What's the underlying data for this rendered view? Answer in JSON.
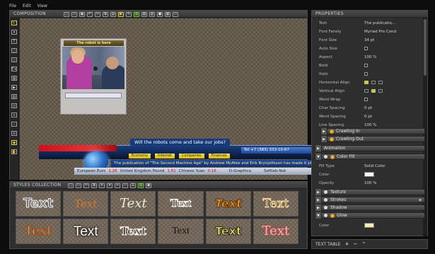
{
  "menu": [
    "File",
    "Edit",
    "View"
  ],
  "composition": {
    "title": "COMPOSITION",
    "photo_title": "The robot is here",
    "lower_third": {
      "question": "Will the robots come and take our jobs?",
      "tel": "Tel  +7 (383) 333-10-67",
      "tabs": [
        "Economy",
        "Internet",
        "Companies",
        "Finances"
      ],
      "ticker": "The publication of \"The Second Machine Age\" by Andrew McAfee and Erik Brynjolfsson has made it plain",
      "rates": [
        {
          "label": "European Euro",
          "value": "1.26"
        },
        {
          "label": "United Kingdom Pound",
          "value": "1.61"
        },
        {
          "label": "Chinese Yuan",
          "value": "0.16"
        }
      ],
      "brand1": "D-Graphica",
      "brand2": "Softlab-Nsk"
    }
  },
  "styles": {
    "title": "STYLES COLLECTION",
    "tiles": [
      "Text",
      "Text",
      "Text",
      "Text",
      "Text",
      "Text",
      "Text",
      "Text",
      "Text",
      "Text",
      "Text",
      "Text"
    ]
  },
  "properties": {
    "title": "PROPERTIES",
    "rows": [
      {
        "k": "Text",
        "v": "The publicatio..."
      },
      {
        "k": "Font Family",
        "v": "Myriad Pro Cond"
      },
      {
        "k": "Font Size",
        "v": "34 pt"
      },
      {
        "k": "Auto Size",
        "v": ""
      },
      {
        "k": "Aspect",
        "v": "100 %"
      },
      {
        "k": "Bold",
        "v": ""
      },
      {
        "k": "Italic",
        "v": ""
      },
      {
        "k": "Horizontal Align",
        "v": ""
      },
      {
        "k": "Vertical Align",
        "v": ""
      },
      {
        "k": "Word Wrap",
        "v": ""
      },
      {
        "k": "Char Spacing",
        "v": "0 pt"
      },
      {
        "k": "Word Spacing",
        "v": "0 pt"
      },
      {
        "k": "Line Spacing",
        "v": "100 %"
      }
    ],
    "sections": {
      "crawling_in": "Crawling In",
      "crawling_out": "Crawling Out",
      "animation": "Animation",
      "color_fill": "Color Fill",
      "texture": "Texture",
      "strokes": "Strokes",
      "shadow": "Shadow",
      "glow": "Glow"
    },
    "fill": [
      {
        "k": "Fill Type",
        "v": "Solid Color"
      },
      {
        "k": "Color",
        "v": ""
      },
      {
        "k": "Opacity",
        "v": "100 %"
      }
    ],
    "glow_color_label": "Color"
  },
  "text_table": {
    "title": "TEXT TABLE"
  }
}
